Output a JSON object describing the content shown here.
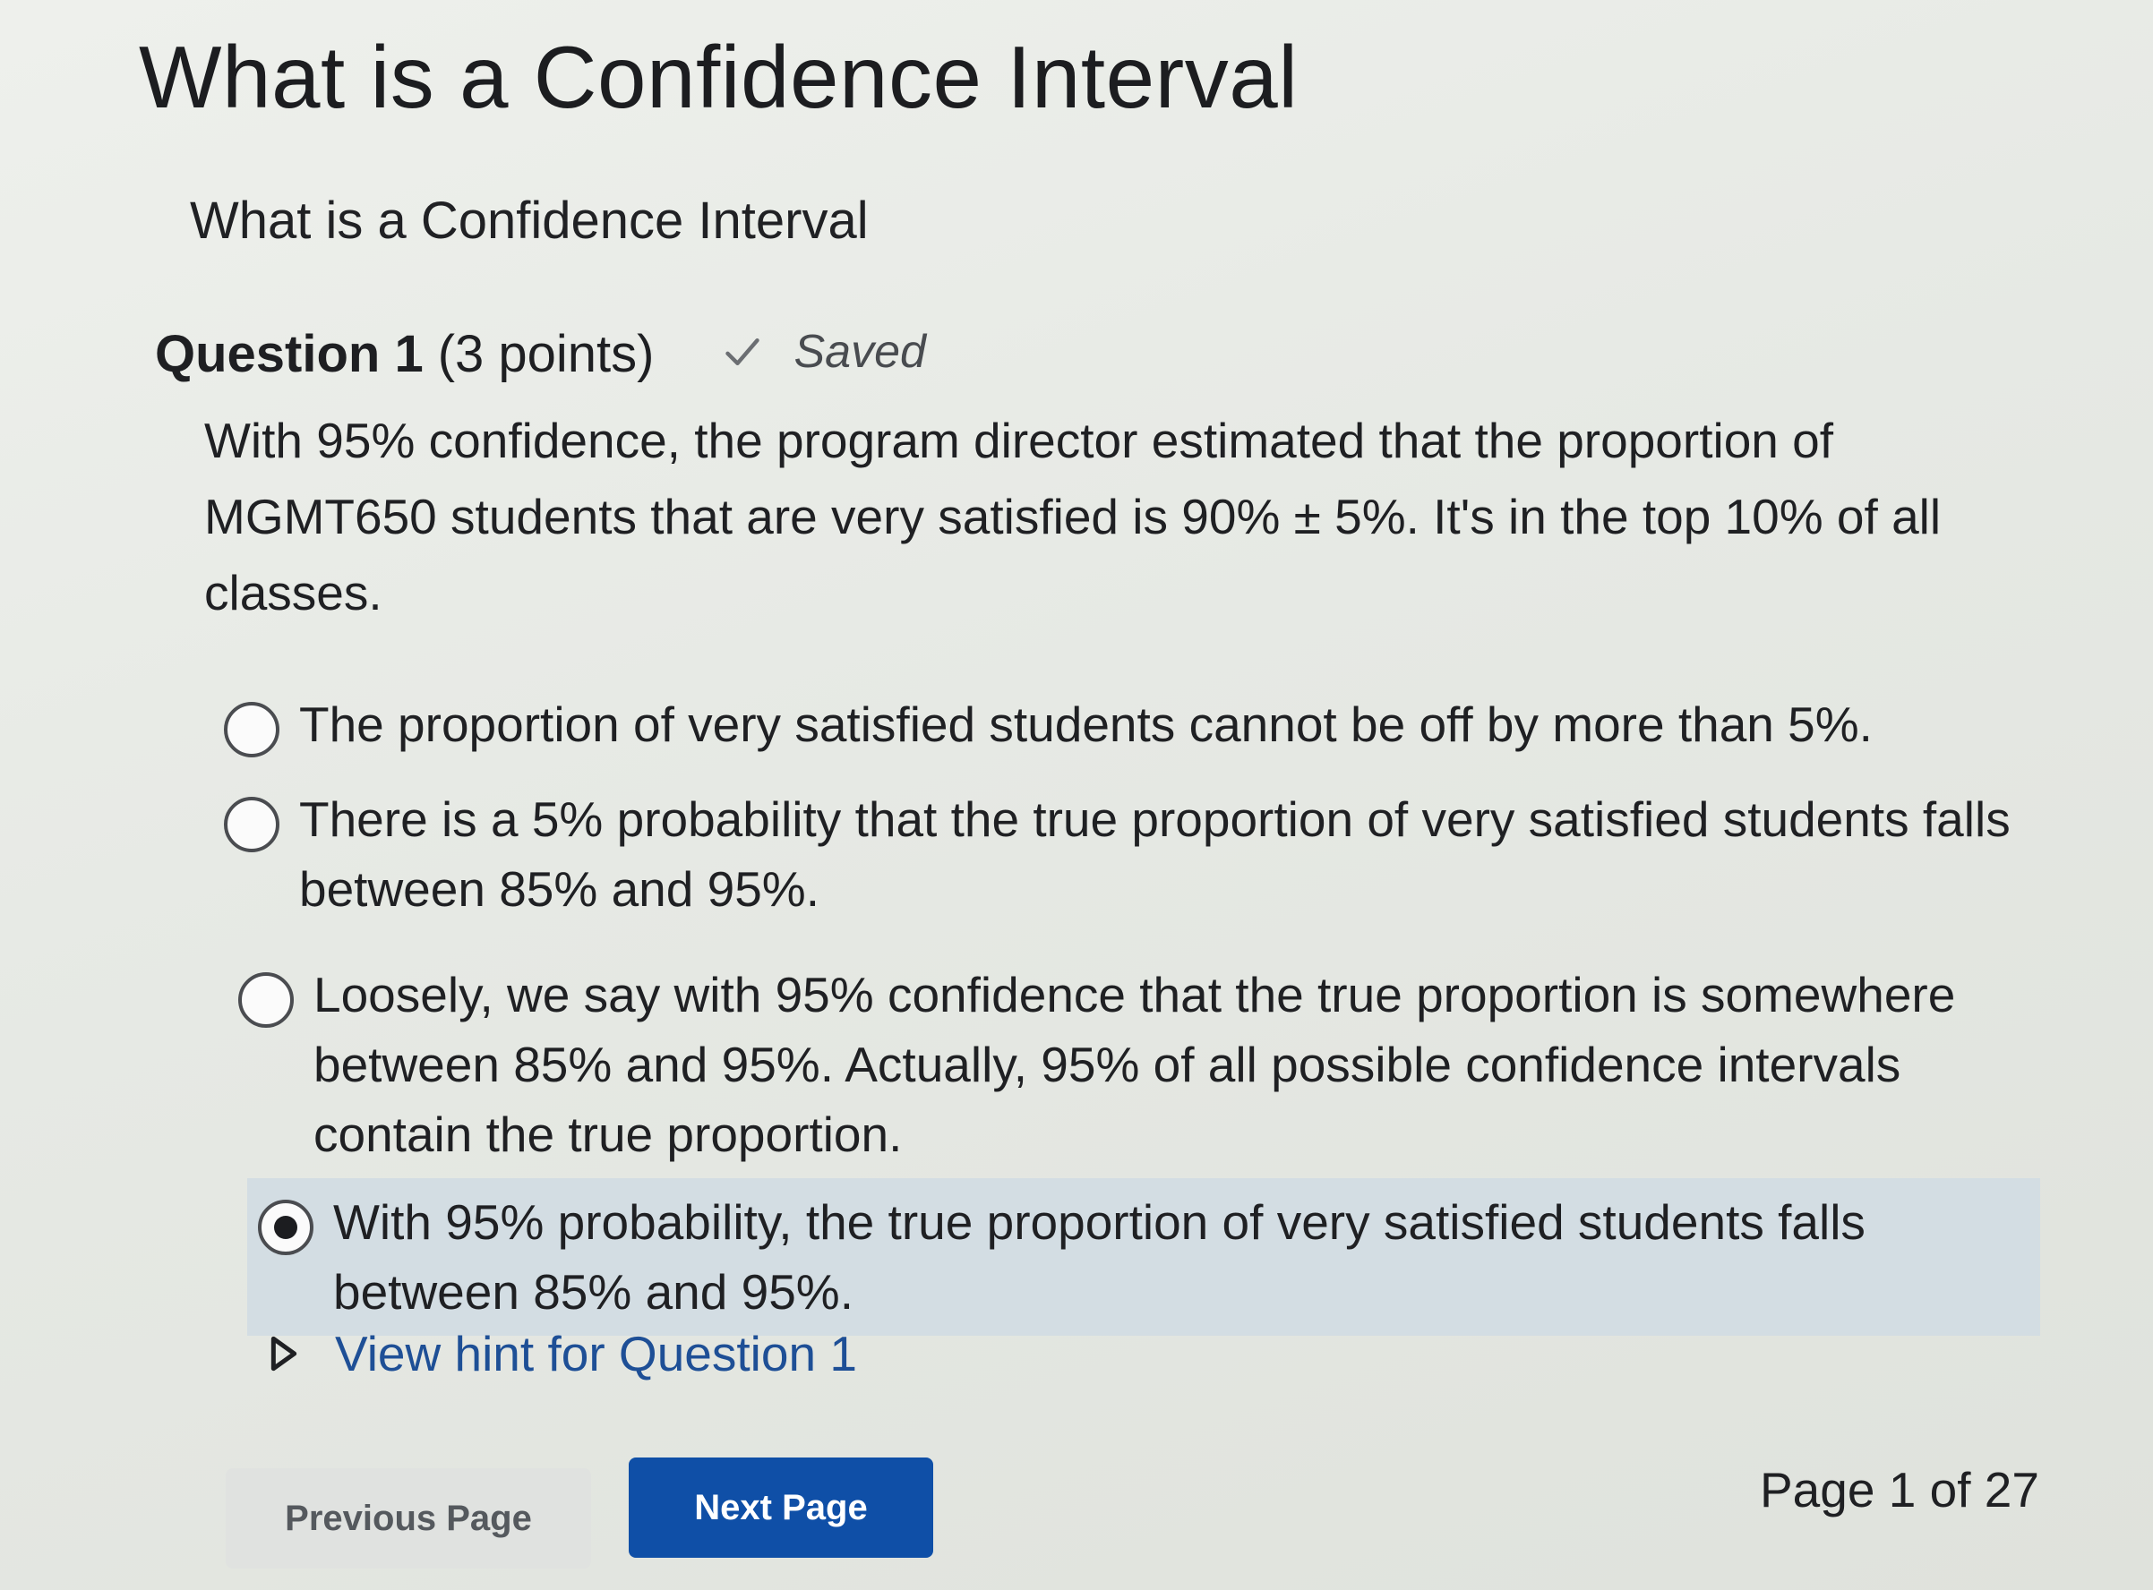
{
  "page": {
    "title": "What is a Confidence Interval"
  },
  "section": {
    "title": "What is a Confidence Interval"
  },
  "question": {
    "label": "Question 1",
    "points": "(3 points)",
    "status": "Saved",
    "status_icon": "check-icon",
    "text": "With 95% confidence, the program director estimated that the proportion of MGMT650 students that are very satisfied is 90% ± 5%. It's in the top 10% of all classes.",
    "options": [
      {
        "text": "The proportion of very satisfied students cannot be off by more than 5%.",
        "selected": false
      },
      {
        "text": "There is a 5% probability that the true proportion of very satisfied students falls between 85% and 95%.",
        "selected": false
      },
      {
        "text": "Loosely, we say with 95% confidence that the true proportion is somewhere between 85% and 95%. Actually, 95% of all possible confidence intervals contain the true proportion.",
        "selected": false
      },
      {
        "text": "With 95% probability, the true proportion of very satisfied students falls between 85% and 95%.",
        "selected": true
      }
    ],
    "hint_label": "View hint for Question 1",
    "hint_icon": "triangle-right-icon"
  },
  "navigation": {
    "previous_label": "Previous Page",
    "next_label": "Next Page",
    "page_indicator": "Page 1 of 27"
  },
  "colors": {
    "link": "#1e4f96",
    "primary_button": "#0f4fa7",
    "selected_option_bg": "#d3dde3"
  }
}
